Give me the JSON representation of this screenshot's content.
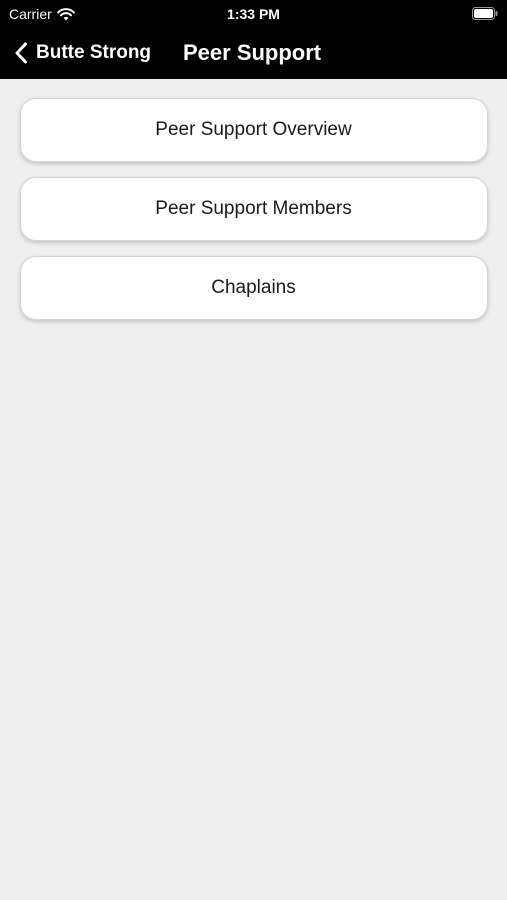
{
  "status_bar": {
    "carrier": "Carrier",
    "time": "1:33 PM",
    "wifi_icon": "wifi-icon",
    "battery_icon": "battery-icon"
  },
  "nav": {
    "back_label": "Butte Strong",
    "back_icon": "chevron-left-icon",
    "title": "Peer Support"
  },
  "menu": {
    "items": [
      {
        "label": "Peer Support Overview"
      },
      {
        "label": "Peer Support Members"
      },
      {
        "label": "Chaplains"
      }
    ]
  },
  "colors": {
    "bar_background": "#000000",
    "content_background": "#efefef",
    "card_background": "#ffffff",
    "text_primary": "#1a1a1a"
  }
}
